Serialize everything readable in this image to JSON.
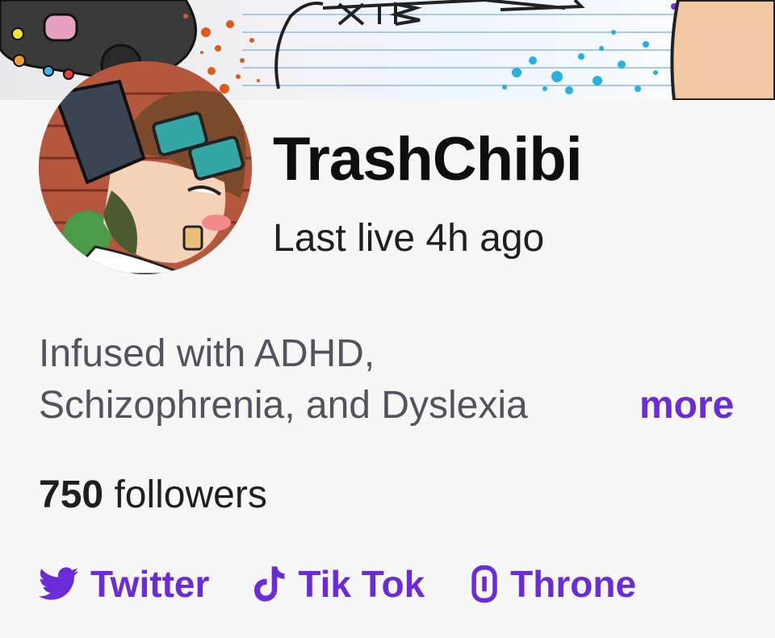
{
  "channel": {
    "name": "TrashChibi",
    "last_live": "Last live 4h ago"
  },
  "bio": {
    "text": "Infused with ADHD, Schizophrenia, and Dyslexia",
    "line1": "Infused with ADHD,",
    "line2": "Schizophrenia, and Dyslexia",
    "more_label": "more"
  },
  "followers": {
    "count": "750",
    "label": "followers"
  },
  "social_links": [
    {
      "label": "Twitter",
      "icon": "twitter-icon"
    },
    {
      "label": "Tik Tok",
      "icon": "tiktok-icon"
    },
    {
      "label": "Throne",
      "icon": "throne-icon"
    }
  ],
  "colors": {
    "accent": "#6a2bd8",
    "background": "#f7f7f8",
    "text_primary": "#0e0e10",
    "text_secondary": "#53535f"
  }
}
